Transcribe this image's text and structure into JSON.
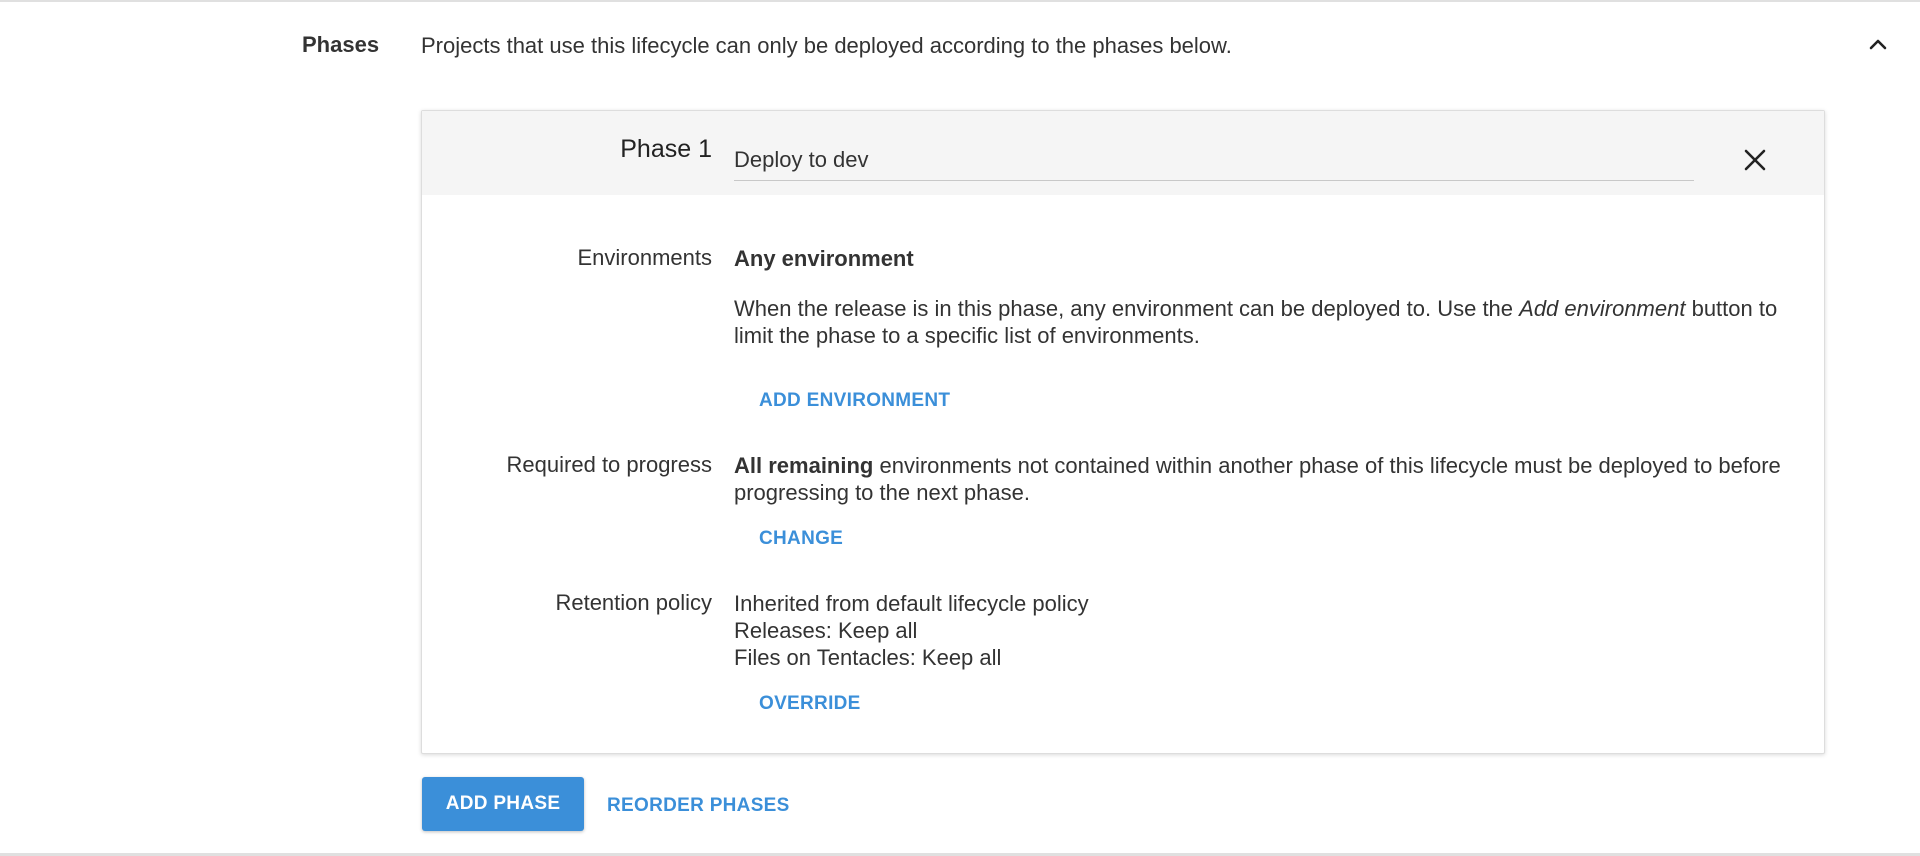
{
  "section": {
    "label": "Phases",
    "description": "Projects that use this lifecycle can only be deployed according to the phases below."
  },
  "phase": {
    "label": "Phase 1",
    "name_value": "Deploy to dev",
    "environments": {
      "label": "Environments",
      "title": "Any environment",
      "desc_before": "When the release is in this phase, any environment can be deployed to. Use the ",
      "desc_em": "Add environment",
      "desc_after": " button to limit the phase to a specific list of environments.",
      "button_label": "ADD ENVIRONMENT"
    },
    "required": {
      "label": "Required to progress",
      "strong": "All remaining",
      "text": " environments not contained within another phase of this lifecycle must be deployed to before progressing to the next phase.",
      "button_label": "CHANGE"
    },
    "retention": {
      "label": "Retention policy",
      "line1": "Inherited from default lifecycle policy",
      "line2": "Releases: Keep all",
      "line3": "Files on Tentacles: Keep all",
      "button_label": "OVERRIDE"
    }
  },
  "actions": {
    "add_phase_label": "ADD PHASE",
    "reorder_label": "REORDER PHASES"
  },
  "icons": {
    "collapse": "chevron-up-icon",
    "remove": "close-icon"
  },
  "colors": {
    "accent": "#3b8fd9",
    "header_bg": "#f5f5f5",
    "text": "#333333"
  }
}
